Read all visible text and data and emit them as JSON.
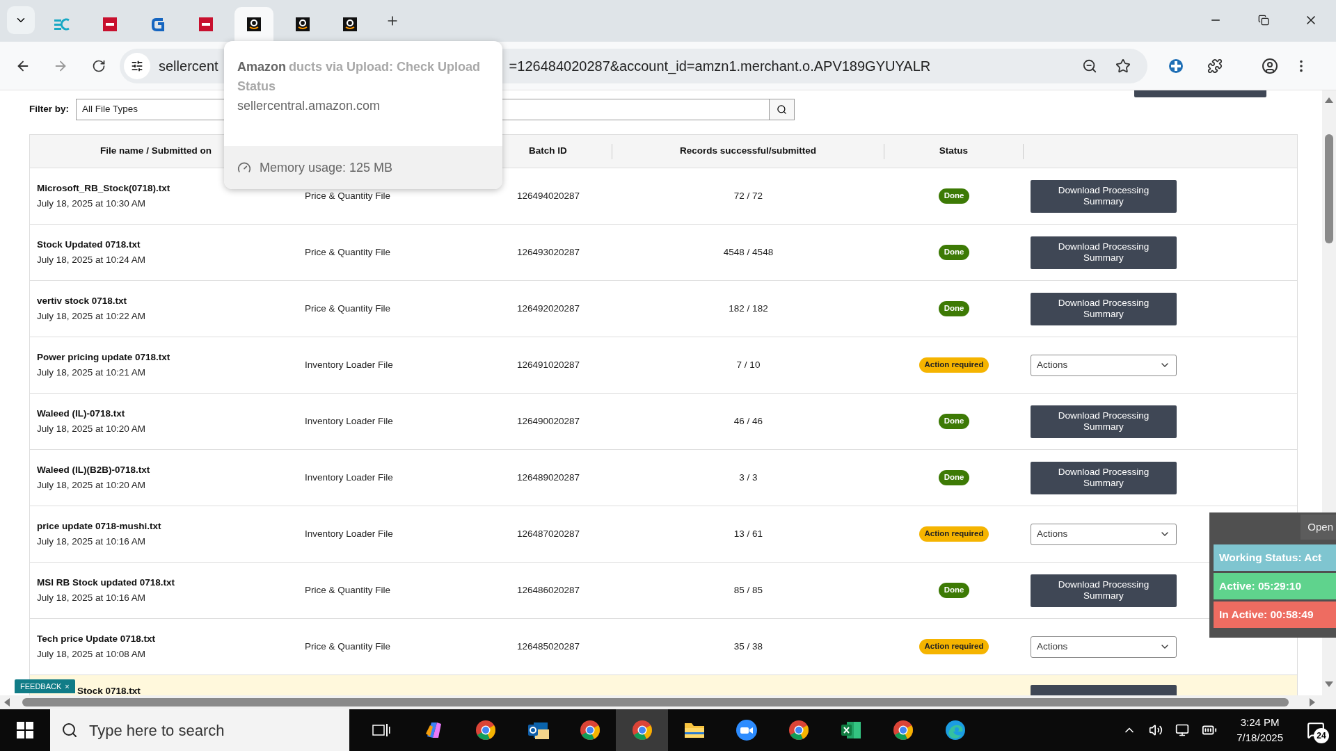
{
  "browser": {
    "tabs": [
      {
        "kind": "ec",
        "selected": false
      },
      {
        "kind": "dh",
        "selected": false
      },
      {
        "kind": "g",
        "selected": false
      },
      {
        "kind": "dh",
        "selected": false
      },
      {
        "kind": "amazon",
        "selected": true
      },
      {
        "kind": "amazon",
        "selected": false
      },
      {
        "kind": "amazon",
        "selected": false
      }
    ],
    "url_start": "sellercent",
    "url_end": "=126484020287&account_id=amzn1.merchant.o.APV189GYUYALR"
  },
  "tab_tooltip": {
    "title": "Amazon",
    "faded_line_1": "ducts via Upload: Check Upload",
    "faded_line_2": "Status",
    "domain": "sellercentral.amazon.com",
    "memory": "Memory usage: 125 MB"
  },
  "filter": {
    "label": "Filter by:",
    "select_value": "All File Types"
  },
  "table": {
    "columns": [
      "File name / Submitted on",
      "Batch ID",
      "Records successful/submitted",
      "Status"
    ],
    "rows": [
      {
        "name": "Microsoft_RB_Stock(0718).txt",
        "date": "July 18, 2025 at 10:30 AM",
        "type": "Price & Quantity File",
        "batch": "126494020287",
        "records": "72 / 72",
        "status": {
          "label": "Done",
          "kind": "done"
        },
        "action": {
          "kind": "button",
          "label": "Download Processing Summary"
        },
        "highlighted": false
      },
      {
        "name": "Stock Updated 0718.txt",
        "date": "July 18, 2025 at 10:24 AM",
        "type": "Price & Quantity File",
        "batch": "126493020287",
        "records": "4548 / 4548",
        "status": {
          "label": "Done",
          "kind": "done"
        },
        "action": {
          "kind": "button",
          "label": "Download Processing Summary"
        },
        "highlighted": false
      },
      {
        "name": "vertiv stock 0718.txt",
        "date": "July 18, 2025 at 10:22 AM",
        "type": "Price & Quantity File",
        "batch": "126492020287",
        "records": "182 / 182",
        "status": {
          "label": "Done",
          "kind": "done"
        },
        "action": {
          "kind": "button",
          "label": "Download Processing Summary"
        },
        "highlighted": false
      },
      {
        "name": "Power pricing update 0718.txt",
        "date": "July 18, 2025 at 10:21 AM",
        "type": "Inventory Loader File",
        "batch": "126491020287",
        "records": "7 / 10",
        "status": {
          "label": "Action required",
          "kind": "action"
        },
        "action": {
          "kind": "dropdown",
          "label": "Actions"
        },
        "highlighted": false
      },
      {
        "name": "Waleed (IL)-0718.txt",
        "date": "July 18, 2025 at 10:20 AM",
        "type": "Inventory Loader File",
        "batch": "126490020287",
        "records": "46 / 46",
        "status": {
          "label": "Done",
          "kind": "done"
        },
        "action": {
          "kind": "button",
          "label": "Download Processing Summary"
        },
        "highlighted": false
      },
      {
        "name": "Waleed (IL)(B2B)-0718.txt",
        "date": "July 18, 2025 at 10:20 AM",
        "type": "Inventory Loader File",
        "batch": "126489020287",
        "records": "3 / 3",
        "status": {
          "label": "Done",
          "kind": "done"
        },
        "action": {
          "kind": "button",
          "label": "Download Processing Summary"
        },
        "highlighted": false
      },
      {
        "name": "price update 0718-mushi.txt",
        "date": "July 18, 2025 at 10:16 AM",
        "type": "Inventory Loader File",
        "batch": "126487020287",
        "records": "13 / 61",
        "status": {
          "label": "Action required",
          "kind": "action"
        },
        "action": {
          "kind": "dropdown",
          "label": "Actions"
        },
        "highlighted": false
      },
      {
        "name": "MSI RB Stock updated 0718.txt",
        "date": "July 18, 2025 at 10:16 AM",
        "type": "Price & Quantity File",
        "batch": "126486020287",
        "records": "85 / 85",
        "status": {
          "label": "Done",
          "kind": "done"
        },
        "action": {
          "kind": "button",
          "label": "Download Processing Summary"
        },
        "highlighted": false
      },
      {
        "name": "Tech price Update 0718.txt",
        "date": "July 18, 2025 at 10:08 AM",
        "type": "Price & Quantity File",
        "batch": "126485020287",
        "records": "35 / 38",
        "status": {
          "label": "Action required",
          "kind": "action"
        },
        "action": {
          "kind": "dropdown",
          "label": "Actions"
        },
        "highlighted": false
      },
      {
        "name": "Stock 0718.txt",
        "partial": true,
        "action": {
          "kind": "cut"
        },
        "highlighted": true
      }
    ]
  },
  "feedback": {
    "label": "FEEDBACK",
    "close": "×"
  },
  "tracker": {
    "open": "Open",
    "status": "Working Status: Act",
    "active": "Active: 05:29:10",
    "inactive": "In Active: 00:58:49"
  },
  "taskbar": {
    "search_placeholder": "Type here to search",
    "apps": [
      {
        "kind": "taskview",
        "selected": false
      },
      {
        "kind": "copilot",
        "selected": false
      },
      {
        "kind": "chrome",
        "selected": false
      },
      {
        "kind": "outlook",
        "selected": false
      },
      {
        "kind": "chrome",
        "selected": false
      },
      {
        "kind": "chrome",
        "selected": true
      },
      {
        "kind": "folder",
        "selected": false
      },
      {
        "kind": "zoom",
        "selected": false
      },
      {
        "kind": "chrome",
        "selected": false
      },
      {
        "kind": "excel",
        "selected": false
      },
      {
        "kind": "chrome",
        "selected": false
      },
      {
        "kind": "edge",
        "selected": false
      }
    ],
    "time": "3:24 PM",
    "date": "7/18/2025",
    "notifications": "24"
  }
}
